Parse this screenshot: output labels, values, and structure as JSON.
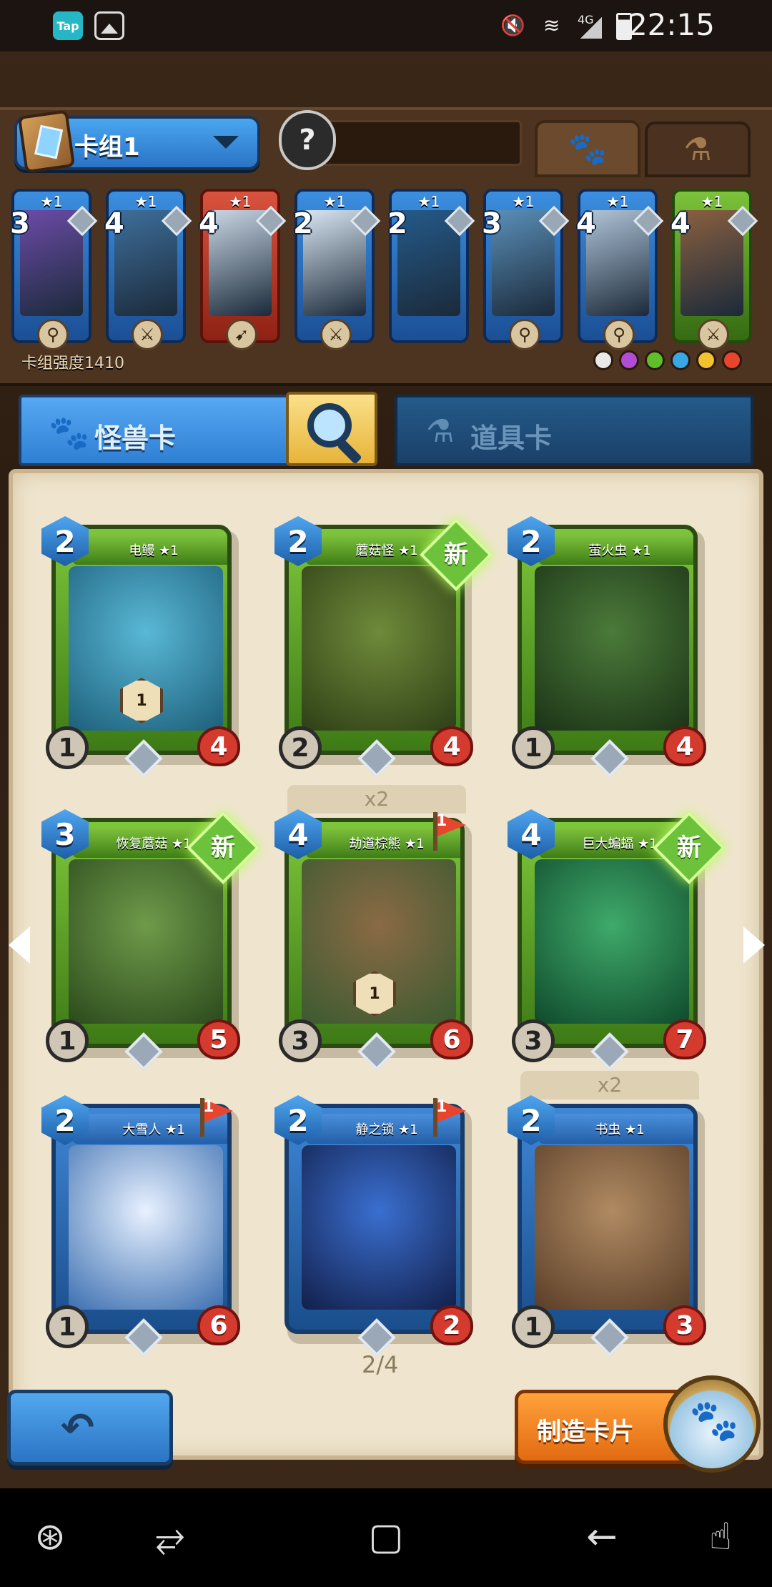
{
  "status_bar": {
    "tap_label": "Tap",
    "icons": [
      "gallery-icon",
      "mute-icon",
      "wifi-icon",
      "signal-4g-icon",
      "battery-icon"
    ],
    "network": "4G",
    "time": "22:15"
  },
  "deck": {
    "name": "卡组1",
    "power_label": "卡组强度1410",
    "tabs": [
      "paw-icon",
      "potion-icon"
    ],
    "hero_icon": "question-icon",
    "cards": [
      {
        "cost": "3",
        "stars": "★1",
        "frame": "blue",
        "weapon": "staff"
      },
      {
        "cost": "4",
        "stars": "★1",
        "frame": "blue",
        "weapon": "sword"
      },
      {
        "cost": "4",
        "stars": "★1",
        "frame": "red",
        "weapon": "bow"
      },
      {
        "cost": "2",
        "stars": "★1",
        "frame": "blue",
        "weapon": "sword"
      },
      {
        "cost": "2",
        "stars": "★1",
        "frame": "blue",
        "weapon": "none"
      },
      {
        "cost": "3",
        "stars": "★1",
        "frame": "blue",
        "weapon": "staff"
      },
      {
        "cost": "4",
        "stars": "★1",
        "frame": "blue",
        "weapon": "staff"
      },
      {
        "cost": "4",
        "stars": "★1",
        "frame": "green",
        "weapon": "sword"
      }
    ],
    "elements": [
      "neutral",
      "arcane",
      "nature",
      "water",
      "wind",
      "fire"
    ],
    "element_colors": [
      "#e9e9e9",
      "#b04cd6",
      "#5fbf2a",
      "#39a7e6",
      "#f2c12e",
      "#e8452f"
    ]
  },
  "categories": {
    "monster_label": "怪兽卡",
    "item_label": "道具卡",
    "search_icon": "search-icon"
  },
  "cards": [
    {
      "name": "电鳗 ★1",
      "cost": "2",
      "atk": "1",
      "hp": "4",
      "frame": "green",
      "badge": "1",
      "new": false,
      "flag": ""
    },
    {
      "name": "蘑菇怪 ★1",
      "cost": "2",
      "atk": "2",
      "hp": "4",
      "frame": "green",
      "badge": "",
      "new": true,
      "flag": ""
    },
    {
      "name": "萤火虫 ★1",
      "cost": "2",
      "atk": "1",
      "hp": "4",
      "frame": "green",
      "badge": "",
      "new": false,
      "flag": ""
    },
    {
      "name": "恢复蘑菇 ★1",
      "cost": "3",
      "atk": "1",
      "hp": "5",
      "frame": "green",
      "badge": "",
      "new": true,
      "flag": ""
    },
    {
      "name": "劫道棕熊 ★1",
      "cost": "4",
      "atk": "3",
      "hp": "6",
      "frame": "green",
      "badge": "1",
      "new": false,
      "flag": "1",
      "dup": "x2"
    },
    {
      "name": "巨大蝙蝠 ★1",
      "cost": "4",
      "atk": "3",
      "hp": "7",
      "frame": "green",
      "badge": "",
      "new": true,
      "flag": ""
    },
    {
      "name": "大雪人 ★1",
      "cost": "2",
      "atk": "1",
      "hp": "6",
      "frame": "blue",
      "badge": "",
      "new": false,
      "flag": "1"
    },
    {
      "name": "静之锁 ★1",
      "cost": "2",
      "atk": "",
      "hp": "2",
      "frame": "blue",
      "badge": "",
      "new": false,
      "flag": "1"
    },
    {
      "name": "书虫 ★1",
      "cost": "2",
      "atk": "1",
      "hp": "3",
      "frame": "blue",
      "badge": "",
      "new": false,
      "flag": "",
      "dup": "x2"
    }
  ],
  "new_label": "新",
  "page_indicator": "2/4",
  "buttons": {
    "back_icon": "back-arrow-icon",
    "craft_label": "制造卡片",
    "craft_icon": "paw-icon"
  },
  "nav_bar": {
    "icons": [
      "game-tools-icon",
      "recents-icon",
      "home-icon",
      "back-icon",
      "gesture-icon"
    ]
  }
}
